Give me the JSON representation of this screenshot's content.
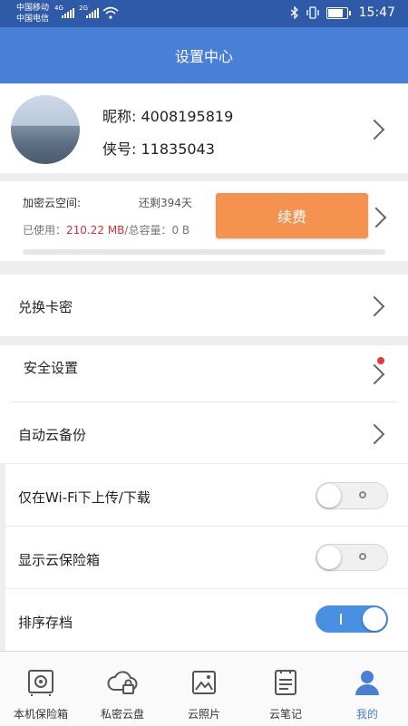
{
  "status_bar": {
    "carrier1": "中国移动",
    "carrier2": "中国电信",
    "net1": "4G",
    "net2": "2G",
    "time": "15:47"
  },
  "header": {
    "title": "设置中心"
  },
  "profile": {
    "nickname": "昵称: 4008195819",
    "xia_id": "侠号: 11835043"
  },
  "storage": {
    "label": "加密云空间:",
    "remaining": "还剩394天",
    "used_prefix": "已使用：",
    "used_value": "210.22 MB",
    "total": "/总容量：0 B",
    "renew_label": "续费",
    "usage_fraction": 0
  },
  "rows": {
    "redeem": "兑换卡密",
    "security": "安全设置",
    "auto_backup": "自动云备份",
    "wifi_only": "仅在Wi-Fi下上传/下载",
    "show_vault": "显示云保险箱",
    "sort_archive": "排序存档"
  },
  "toggles": {
    "wifi_only": false,
    "show_vault": false,
    "sort_archive": true
  },
  "nav": [
    {
      "label": "本机保险箱",
      "icon": "safe-icon"
    },
    {
      "label": "私密云盘",
      "icon": "cloud-lock-icon"
    },
    {
      "label": "云照片",
      "icon": "photo-icon"
    },
    {
      "label": "云笔记",
      "icon": "note-icon"
    },
    {
      "label": "我的",
      "icon": "person-icon"
    }
  ],
  "colors": {
    "header": "#4a7fd8",
    "status_bar": "#2e5aa7",
    "renew_button": "#f69250",
    "used_value": "#d8303a",
    "toggle_on": "#4a90e2",
    "active_nav": "#4a7fd8",
    "badge_dot": "#e53935"
  }
}
